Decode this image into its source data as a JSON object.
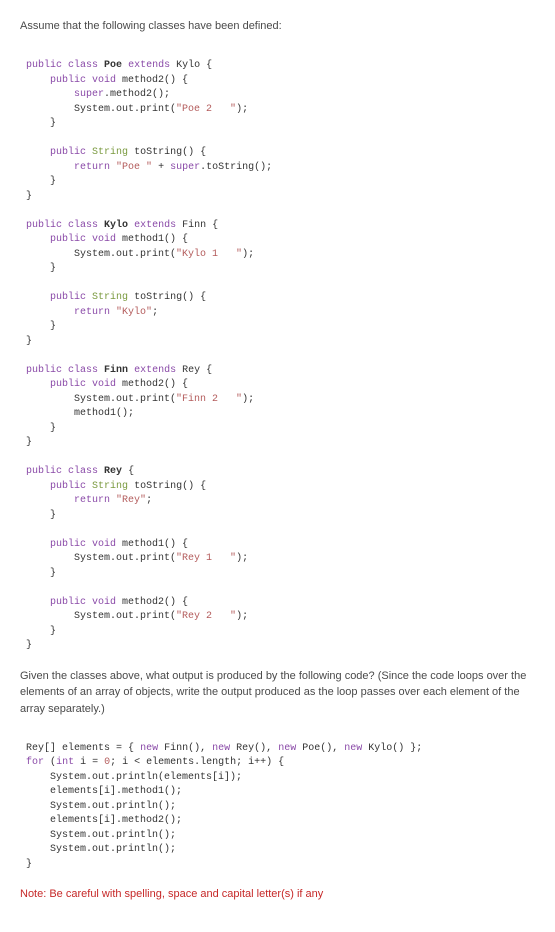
{
  "intro": "Assume that the following classes have been defined:",
  "code1": {
    "l1": {
      "a": "public class",
      "b": "Poe",
      "c": "extends",
      "d": "Kylo {"
    },
    "l2": {
      "a": "public void",
      "b": "method2() {"
    },
    "l3": {
      "a": "super",
      "b": ".method2();"
    },
    "l4": {
      "a": "System.out.print(",
      "b": "\"Poe 2   \"",
      "c": ");"
    },
    "l5": "}",
    "l6": "",
    "l7": {
      "a": "public",
      "b": "String",
      "c": "toString() {"
    },
    "l8": {
      "a": "return",
      "b": "\"Poe \"",
      "c": "+",
      "d": "super",
      "e": ".toString();"
    },
    "l9": "}",
    "l10": "}",
    "l11": "",
    "l12": {
      "a": "public class",
      "b": "Kylo",
      "c": "extends",
      "d": "Finn {"
    },
    "l13": {
      "a": "public void",
      "b": "method1() {"
    },
    "l14": {
      "a": "System.out.print(",
      "b": "\"Kylo 1   \"",
      "c": ");"
    },
    "l15": "}",
    "l16": "",
    "l17": {
      "a": "public",
      "b": "String",
      "c": "toString() {"
    },
    "l18": {
      "a": "return",
      "b": "\"Kylo\"",
      "c": ";"
    },
    "l19": "}",
    "l20": "}",
    "l21": "",
    "l22": {
      "a": "public class",
      "b": "Finn",
      "c": "extends",
      "d": "Rey {"
    },
    "l23": {
      "a": "public void",
      "b": "method2() {"
    },
    "l24": {
      "a": "System.out.print(",
      "b": "\"Finn 2   \"",
      "c": ");"
    },
    "l25": "method1();",
    "l26": "}",
    "l27": "}",
    "l28": "",
    "l29": {
      "a": "public class",
      "b": "Rey",
      "c": "{"
    },
    "l30": {
      "a": "public",
      "b": "String",
      "c": "toString() {"
    },
    "l31": {
      "a": "return",
      "b": "\"Rey\"",
      "c": ";"
    },
    "l32": "}",
    "l33": "",
    "l34": {
      "a": "public void",
      "b": "method1() {"
    },
    "l35": {
      "a": "System.out.print(",
      "b": "\"Rey 1   \"",
      "c": ");"
    },
    "l36": "}",
    "l37": "",
    "l38": {
      "a": "public void",
      "b": "method2() {"
    },
    "l39": {
      "a": "System.out.print(",
      "b": "\"Rey 2   \"",
      "c": ");"
    },
    "l40": "}",
    "l41": "}"
  },
  "explain": "Given the classes above, what output is produced by the following code? (Since the code loops over the elements of an array of objects, write the output produced as the loop passes over each element of the array separately.)",
  "code2": {
    "l1": {
      "a": "Rey[] elements = {",
      "b": "new",
      "c": "Finn(),",
      "d": "new",
      "e": "Rey(),",
      "f": "new",
      "g": "Poe(),",
      "h": "new",
      "i": "Kylo() };"
    },
    "l2": {
      "a": "for",
      "b": "(",
      "c": "int",
      "d": "i =",
      "e": "0",
      "f": "; i < elements.length; i++) {"
    },
    "l3": "System.out.println(elements[i]);",
    "l4": "elements[i].method1();",
    "l5": "System.out.println();",
    "l6": "elements[i].method2();",
    "l7": "System.out.println();",
    "l8": "System.out.println();",
    "l9": "}"
  },
  "note": "Note: Be careful with spelling, space and capital letter(s) if any"
}
